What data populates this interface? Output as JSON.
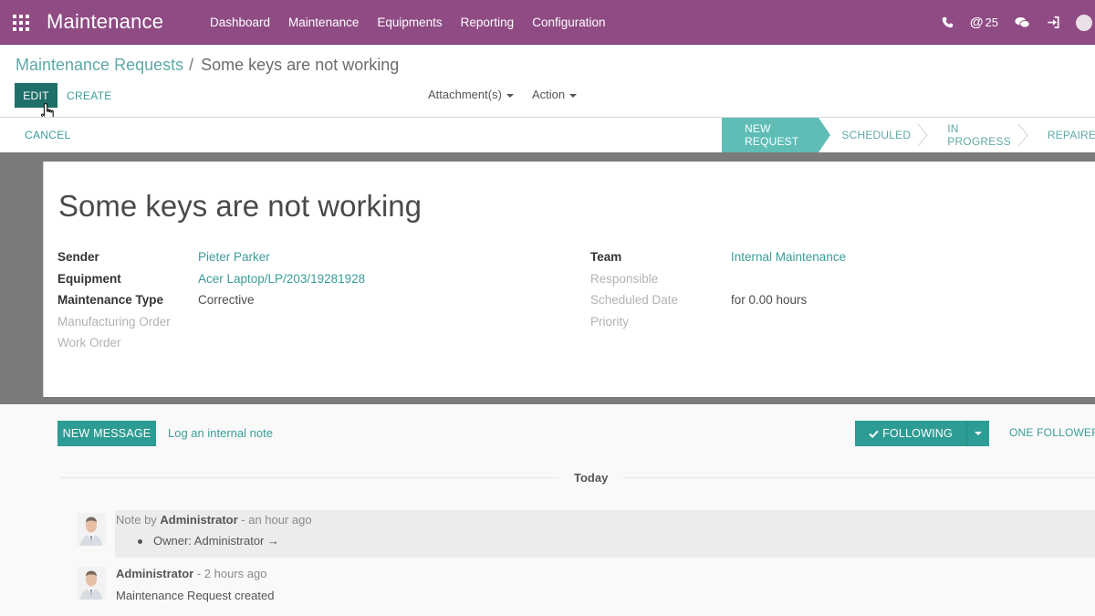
{
  "navbar": {
    "brand": "Maintenance",
    "menu": [
      "Dashboard",
      "Maintenance",
      "Equipments",
      "Reporting",
      "Configuration"
    ],
    "mentions_count": "25"
  },
  "breadcrumb": {
    "parent": "Maintenance Requests",
    "separator": "/",
    "current": "Some keys are not working"
  },
  "toolbar": {
    "edit_label": "EDIT",
    "create_label": "CREATE",
    "attachments_label": "Attachment(s)",
    "action_label": "Action",
    "cancel_label": "CANCEL"
  },
  "stages": [
    {
      "label": "NEW REQUEST",
      "active": true
    },
    {
      "label": "SCHEDULED",
      "active": false
    },
    {
      "label": "IN PROGRESS",
      "active": false
    },
    {
      "label": "REPAIRED",
      "active": false
    }
  ],
  "record": {
    "title": "Some keys are not working",
    "left_fields": [
      {
        "label": "Sender",
        "value": "Pieter Parker"
      },
      {
        "label": "Equipment",
        "value": "Acer Laptop/LP/203/19281928"
      },
      {
        "label": "Maintenance Type",
        "value": "Corrective"
      },
      {
        "label": "Manufacturing Order",
        "value": ""
      },
      {
        "label": "Work Order",
        "value": ""
      }
    ],
    "right_fields": [
      {
        "label": "Team",
        "value": "Internal Maintenance"
      },
      {
        "label": "Responsible",
        "value": ""
      },
      {
        "label": "Scheduled Date",
        "value": "for 0.00 hours"
      },
      {
        "label": "Priority",
        "value": ""
      }
    ]
  },
  "chatter": {
    "new_message_label": "NEW MESSAGE",
    "log_note_label": "Log an internal note",
    "following_label": "FOLLOWING",
    "followers_label": "ONE FOLLOWER",
    "date_separator": "Today",
    "messages": [
      {
        "prefix": "Note by ",
        "author": "Administrator",
        "time": " - an hour ago",
        "body": "Owner: Administrator →"
      },
      {
        "prefix": "",
        "author": "Administrator",
        "time": " - 2 hours ago",
        "body": "Maintenance Request created"
      }
    ]
  },
  "colors": {
    "navbar": "#8f4b84",
    "primary": "#2d9c94",
    "link": "#3a9d98",
    "stage_active": "#5fbdb6"
  }
}
